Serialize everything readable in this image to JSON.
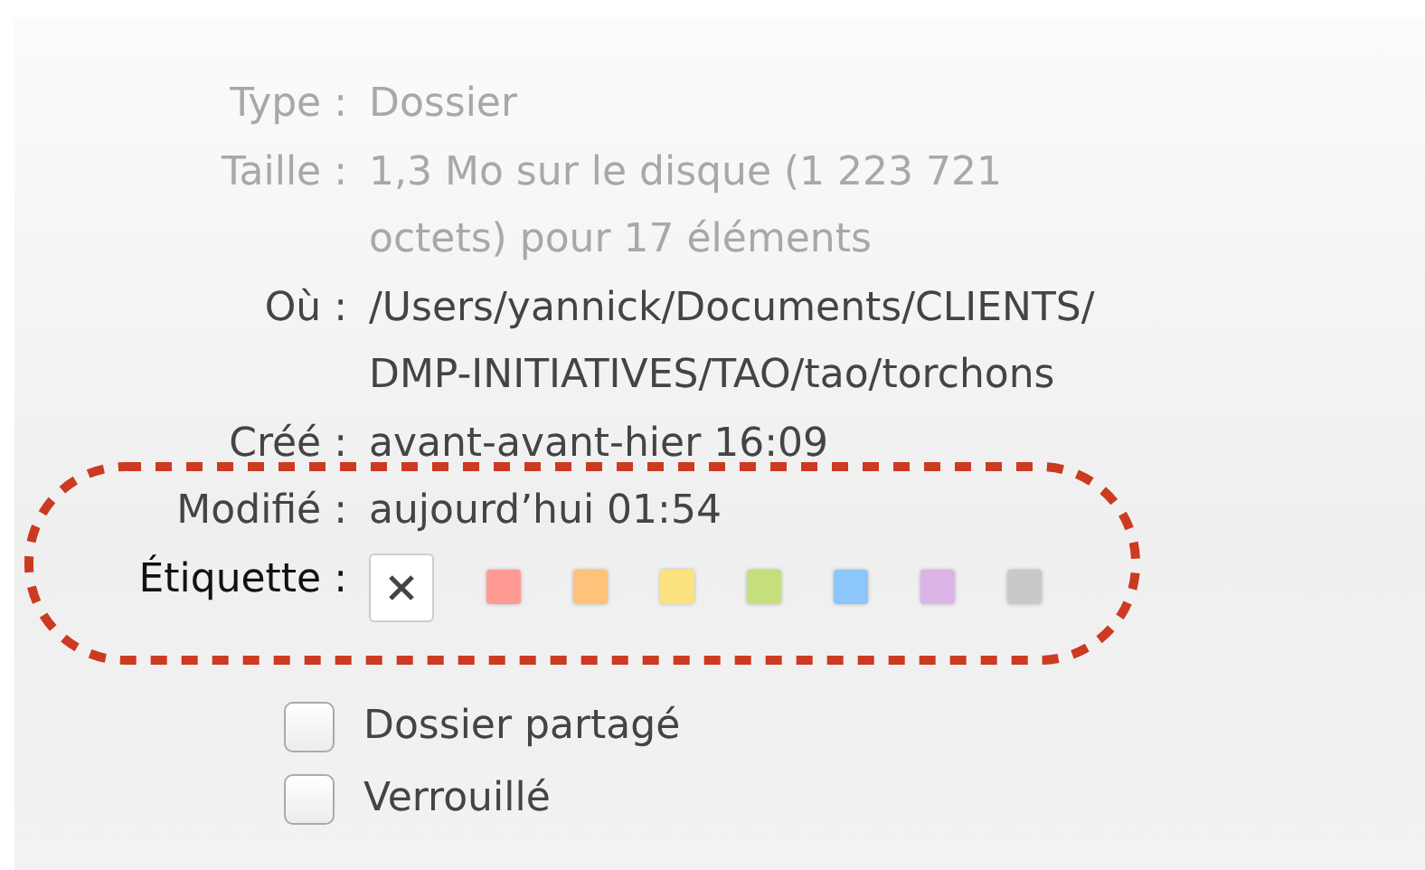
{
  "info": [
    {
      "label": "Type :",
      "value": "Dossier",
      "dimmed": true
    },
    {
      "label": "Taille :",
      "value": "1,3 Mo sur le disque (1 223 721 octets) pour 17 éléments",
      "dimmed": true
    },
    {
      "label": "Où :",
      "value": "/Users/yannick/Documents/CLIENTS/ DMP-INITIATIVES/TAO/tao/torchons",
      "dimmed": false
    },
    {
      "label": "Créé :",
      "value": "avant-avant-hier 16:09",
      "dimmed": false
    },
    {
      "label": "Modifié :",
      "value": "aujourd’hui 01:54",
      "dimmed": false
    }
  ],
  "label_picker": {
    "label": "Étiquette :",
    "swatches": [
      {
        "kind": "none",
        "selected": true
      },
      {
        "kind": "color",
        "color": "#ff9a94",
        "selected": false
      },
      {
        "kind": "color",
        "color": "#ffc27a",
        "selected": false
      },
      {
        "kind": "color",
        "color": "#fbe27f",
        "selected": false
      },
      {
        "kind": "color",
        "color": "#c4df7b",
        "selected": false
      },
      {
        "kind": "color",
        "color": "#8cc6fa",
        "selected": false
      },
      {
        "kind": "color",
        "color": "#dbb5e8",
        "selected": false
      },
      {
        "kind": "color",
        "color": "#c9c9c9",
        "selected": false
      }
    ]
  },
  "checkboxes": [
    {
      "label": "Dossier partagé",
      "checked": false
    },
    {
      "label": "Verrouillé",
      "checked": false
    }
  ]
}
